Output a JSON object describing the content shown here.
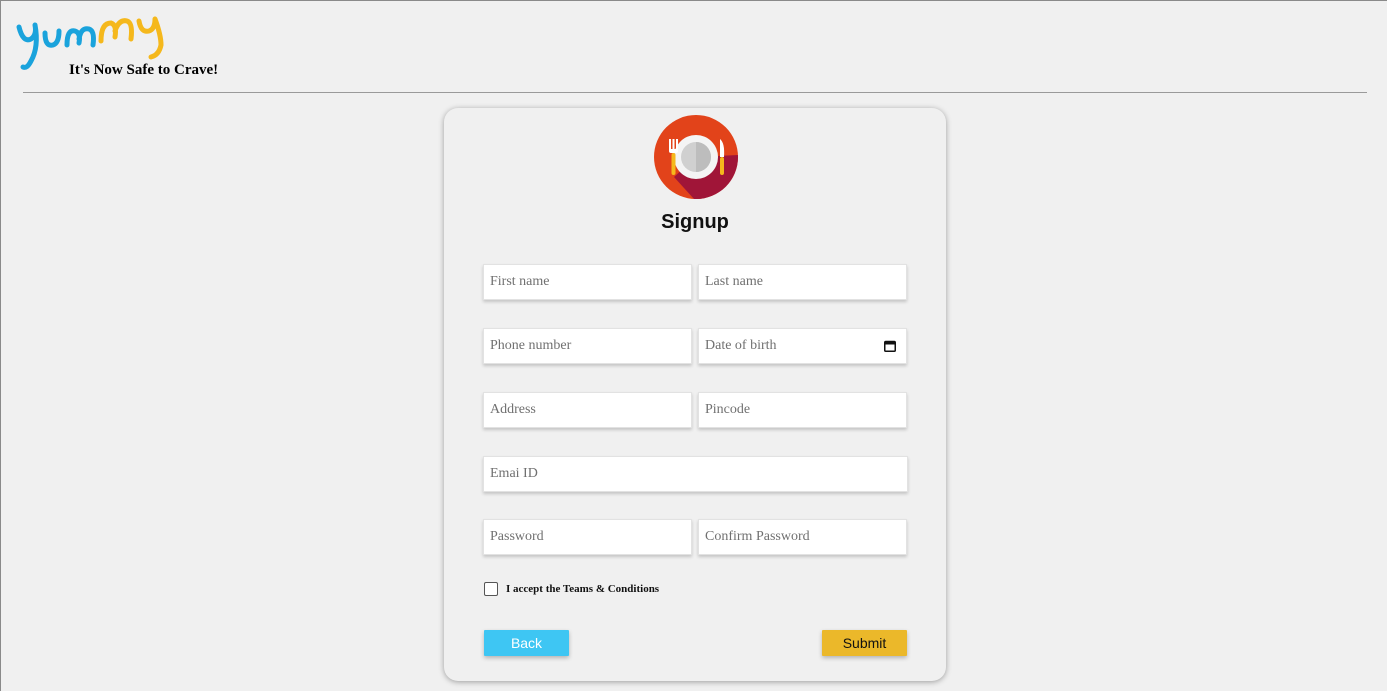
{
  "header": {
    "logo_text": "yummy",
    "tagline": "It's Now Safe to Crave!"
  },
  "form": {
    "title": "Signup",
    "fields": {
      "first_name": "First name",
      "last_name": "Last name",
      "phone": "Phone number",
      "dob": "Date of birth",
      "address": "Address",
      "pincode": "Pincode",
      "email": "Emai ID",
      "password": "Password",
      "confirm_password": "Confirm Password"
    },
    "terms_label": "I accept the Teams & Conditions",
    "terms_checked": false,
    "back_label": "Back",
    "submit_label": "Submit"
  },
  "icons": {
    "logo": "yummy-logo",
    "form_icon": "plate-fork-knife-icon",
    "calendar": "calendar-icon"
  },
  "colors": {
    "back_button": "#3ec6f3",
    "submit_button": "#ebb82a",
    "logo_blue": "#1aa3dc",
    "logo_yellow": "#f5b81c",
    "plate_bg": "#e2431a"
  }
}
